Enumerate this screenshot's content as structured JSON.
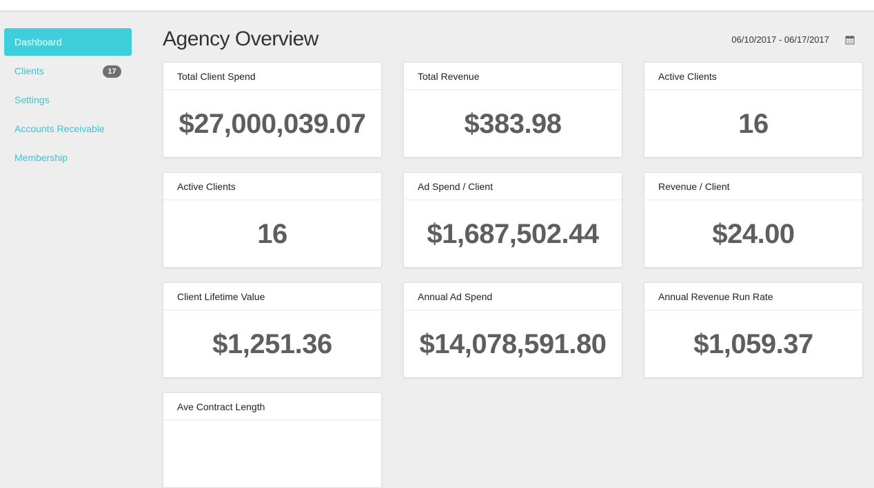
{
  "sidebar": {
    "items": [
      {
        "label": "Dashboard"
      },
      {
        "label": "Clients",
        "badge": "17"
      },
      {
        "label": "Settings"
      },
      {
        "label": "Accounts Receivable"
      },
      {
        "label": "Membership"
      }
    ]
  },
  "header": {
    "title": "Agency Overview",
    "date_range": "06/10/2017 - 06/17/2017"
  },
  "cards": [
    {
      "label": "Total Client Spend",
      "value": "$27,000,039.07"
    },
    {
      "label": "Total Revenue",
      "value": "$383.98"
    },
    {
      "label": "Active Clients",
      "value": "16"
    },
    {
      "label": "Active Clients",
      "value": "16"
    },
    {
      "label": "Ad Spend / Client",
      "value": "$1,687,502.44"
    },
    {
      "label": "Revenue / Client",
      "value": "$24.00"
    },
    {
      "label": "Client Lifetime Value",
      "value": "$1,251.36"
    },
    {
      "label": "Annual Ad Spend",
      "value": "$14,078,591.80"
    },
    {
      "label": "Annual Revenue Run Rate",
      "value": "$1,059.37"
    },
    {
      "label": "Ave Contract Length",
      "value": ""
    }
  ],
  "colors": {
    "accent": "#3ecfdc",
    "link": "#3cc3d6",
    "badge": "#6f6f6f",
    "value_text": "#5e5e5e"
  }
}
